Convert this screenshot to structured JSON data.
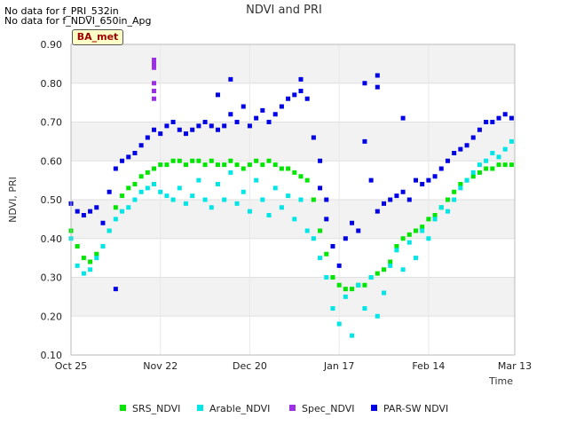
{
  "notes": {
    "line1": "No data for f_PRI_532in",
    "line2": "No data for f_NDVI_650in_Apg"
  },
  "badge": "BA_met",
  "chart_data": {
    "type": "scatter",
    "title": "NDVI and PRI",
    "xlabel": "Time",
    "ylabel": "NDVI, PRI",
    "ylim": [
      0.1,
      0.9
    ],
    "yticks": [
      "0.10",
      "0.20",
      "0.30",
      "0.40",
      "0.50",
      "0.60",
      "0.70",
      "0.80",
      "0.90"
    ],
    "xlim": [
      "2017-10-25",
      "2018-03-13"
    ],
    "xticks": [
      {
        "date": "2017-10-25",
        "label": "Oct 25"
      },
      {
        "date": "2017-11-22",
        "label": "Nov 22"
      },
      {
        "date": "2017-12-20",
        "label": "Dec 20"
      },
      {
        "date": "2018-01-17",
        "label": "Jan 17"
      },
      {
        "date": "2018-02-14",
        "label": "Feb 14"
      },
      {
        "date": "2018-03-13",
        "label": "Mar 13"
      }
    ],
    "grid": true,
    "legend_position": "bottom",
    "series": [
      {
        "name": "SRS_NDVI",
        "color": "#00e600",
        "points": [
          [
            "2017-10-25",
            0.42
          ],
          [
            "2017-10-27",
            0.38
          ],
          [
            "2017-10-29",
            0.35
          ],
          [
            "2017-10-31",
            0.34
          ],
          [
            "2017-11-02",
            0.36
          ],
          [
            "2017-11-04",
            0.38
          ],
          [
            "2017-11-06",
            0.42
          ],
          [
            "2017-11-08",
            0.48
          ],
          [
            "2017-11-10",
            0.51
          ],
          [
            "2017-11-12",
            0.53
          ],
          [
            "2017-11-14",
            0.54
          ],
          [
            "2017-11-16",
            0.56
          ],
          [
            "2017-11-18",
            0.57
          ],
          [
            "2017-11-20",
            0.58
          ],
          [
            "2017-11-22",
            0.59
          ],
          [
            "2017-11-24",
            0.59
          ],
          [
            "2017-11-26",
            0.6
          ],
          [
            "2017-11-28",
            0.6
          ],
          [
            "2017-11-30",
            0.59
          ],
          [
            "2017-12-02",
            0.6
          ],
          [
            "2017-12-04",
            0.6
          ],
          [
            "2017-12-06",
            0.59
          ],
          [
            "2017-12-08",
            0.6
          ],
          [
            "2017-12-10",
            0.59
          ],
          [
            "2017-12-12",
            0.59
          ],
          [
            "2017-12-14",
            0.6
          ],
          [
            "2017-12-16",
            0.59
          ],
          [
            "2017-12-18",
            0.58
          ],
          [
            "2017-12-20",
            0.59
          ],
          [
            "2017-12-22",
            0.6
          ],
          [
            "2017-12-24",
            0.59
          ],
          [
            "2017-12-26",
            0.6
          ],
          [
            "2017-12-28",
            0.59
          ],
          [
            "2017-12-30",
            0.58
          ],
          [
            "2018-01-01",
            0.58
          ],
          [
            "2018-01-03",
            0.57
          ],
          [
            "2018-01-05",
            0.56
          ],
          [
            "2018-01-07",
            0.55
          ],
          [
            "2018-01-09",
            0.5
          ],
          [
            "2018-01-11",
            0.42
          ],
          [
            "2018-01-13",
            0.36
          ],
          [
            "2018-01-15",
            0.3
          ],
          [
            "2018-01-17",
            0.28
          ],
          [
            "2018-01-19",
            0.27
          ],
          [
            "2018-01-21",
            0.27
          ],
          [
            "2018-01-23",
            0.28
          ],
          [
            "2018-01-25",
            0.28
          ],
          [
            "2018-01-27",
            0.3
          ],
          [
            "2018-01-29",
            0.31
          ],
          [
            "2018-01-31",
            0.32
          ],
          [
            "2018-02-02",
            0.34
          ],
          [
            "2018-02-04",
            0.38
          ],
          [
            "2018-02-06",
            0.4
          ],
          [
            "2018-02-08",
            0.41
          ],
          [
            "2018-02-10",
            0.42
          ],
          [
            "2018-02-12",
            0.43
          ],
          [
            "2018-02-14",
            0.45
          ],
          [
            "2018-02-16",
            0.46
          ],
          [
            "2018-02-18",
            0.48
          ],
          [
            "2018-02-20",
            0.5
          ],
          [
            "2018-02-22",
            0.52
          ],
          [
            "2018-02-24",
            0.54
          ],
          [
            "2018-02-26",
            0.55
          ],
          [
            "2018-02-28",
            0.56
          ],
          [
            "2018-03-02",
            0.57
          ],
          [
            "2018-03-04",
            0.58
          ],
          [
            "2018-03-06",
            0.58
          ],
          [
            "2018-03-08",
            0.59
          ],
          [
            "2018-03-10",
            0.59
          ],
          [
            "2018-03-12",
            0.59
          ]
        ]
      },
      {
        "name": "Arable_NDVI",
        "color": "#00e6e6",
        "points": [
          [
            "2017-10-25",
            0.4
          ],
          [
            "2017-10-27",
            0.33
          ],
          [
            "2017-10-29",
            0.31
          ],
          [
            "2017-10-31",
            0.32
          ],
          [
            "2017-11-02",
            0.35
          ],
          [
            "2017-11-04",
            0.38
          ],
          [
            "2017-11-06",
            0.42
          ],
          [
            "2017-11-08",
            0.45
          ],
          [
            "2017-11-10",
            0.47
          ],
          [
            "2017-11-12",
            0.48
          ],
          [
            "2017-11-14",
            0.5
          ],
          [
            "2017-11-16",
            0.52
          ],
          [
            "2017-11-18",
            0.53
          ],
          [
            "2017-11-20",
            0.54
          ],
          [
            "2017-11-22",
            0.52
          ],
          [
            "2017-11-24",
            0.51
          ],
          [
            "2017-11-26",
            0.5
          ],
          [
            "2017-11-28",
            0.53
          ],
          [
            "2017-11-30",
            0.49
          ],
          [
            "2017-12-02",
            0.51
          ],
          [
            "2017-12-04",
            0.55
          ],
          [
            "2017-12-06",
            0.5
          ],
          [
            "2017-12-08",
            0.48
          ],
          [
            "2017-12-10",
            0.54
          ],
          [
            "2017-12-12",
            0.5
          ],
          [
            "2017-12-14",
            0.57
          ],
          [
            "2017-12-16",
            0.49
          ],
          [
            "2017-12-18",
            0.52
          ],
          [
            "2017-12-20",
            0.47
          ],
          [
            "2017-12-22",
            0.55
          ],
          [
            "2017-12-24",
            0.5
          ],
          [
            "2017-12-26",
            0.46
          ],
          [
            "2017-12-28",
            0.53
          ],
          [
            "2017-12-30",
            0.48
          ],
          [
            "2018-01-01",
            0.51
          ],
          [
            "2018-01-03",
            0.45
          ],
          [
            "2018-01-05",
            0.5
          ],
          [
            "2018-01-07",
            0.42
          ],
          [
            "2018-01-09",
            0.4
          ],
          [
            "2018-01-11",
            0.35
          ],
          [
            "2018-01-13",
            0.3
          ],
          [
            "2018-01-15",
            0.22
          ],
          [
            "2018-01-17",
            0.18
          ],
          [
            "2018-01-19",
            0.25
          ],
          [
            "2018-01-21",
            0.15
          ],
          [
            "2018-01-23",
            0.28
          ],
          [
            "2018-01-25",
            0.22
          ],
          [
            "2018-01-27",
            0.3
          ],
          [
            "2018-01-29",
            0.2
          ],
          [
            "2018-01-31",
            0.26
          ],
          [
            "2018-02-02",
            0.33
          ],
          [
            "2018-02-04",
            0.37
          ],
          [
            "2018-02-06",
            0.32
          ],
          [
            "2018-02-08",
            0.39
          ],
          [
            "2018-02-10",
            0.35
          ],
          [
            "2018-02-12",
            0.42
          ],
          [
            "2018-02-14",
            0.4
          ],
          [
            "2018-02-16",
            0.45
          ],
          [
            "2018-02-18",
            0.48
          ],
          [
            "2018-02-20",
            0.47
          ],
          [
            "2018-02-22",
            0.5
          ],
          [
            "2018-02-24",
            0.53
          ],
          [
            "2018-02-26",
            0.55
          ],
          [
            "2018-02-28",
            0.57
          ],
          [
            "2018-03-02",
            0.59
          ],
          [
            "2018-03-04",
            0.6
          ],
          [
            "2018-03-06",
            0.62
          ],
          [
            "2018-03-08",
            0.61
          ],
          [
            "2018-03-10",
            0.63
          ],
          [
            "2018-03-12",
            0.65
          ]
        ]
      },
      {
        "name": "Spec_NDVI",
        "color": "#9b30e6",
        "points": [
          [
            "2017-11-20",
            0.86
          ],
          [
            "2017-11-20",
            0.85
          ],
          [
            "2017-11-20",
            0.84
          ],
          [
            "2017-11-20",
            0.8
          ],
          [
            "2017-11-20",
            0.78
          ],
          [
            "2017-11-20",
            0.76
          ]
        ]
      },
      {
        "name": "PAR-SW NDVI",
        "color": "#0000e6",
        "points": [
          [
            "2017-10-25",
            0.49
          ],
          [
            "2017-10-27",
            0.47
          ],
          [
            "2017-10-29",
            0.46
          ],
          [
            "2017-10-31",
            0.47
          ],
          [
            "2017-11-02",
            0.48
          ],
          [
            "2017-11-04",
            0.44
          ],
          [
            "2017-11-06",
            0.52
          ],
          [
            "2017-11-08",
            0.58
          ],
          [
            "2017-11-10",
            0.6
          ],
          [
            "2017-11-12",
            0.61
          ],
          [
            "2017-11-14",
            0.62
          ],
          [
            "2017-11-16",
            0.64
          ],
          [
            "2017-11-18",
            0.66
          ],
          [
            "2017-11-20",
            0.68
          ],
          [
            "2017-11-22",
            0.67
          ],
          [
            "2017-11-24",
            0.69
          ],
          [
            "2017-11-26",
            0.7
          ],
          [
            "2017-11-28",
            0.68
          ],
          [
            "2017-11-30",
            0.67
          ],
          [
            "2017-12-02",
            0.68
          ],
          [
            "2017-12-04",
            0.69
          ],
          [
            "2017-12-06",
            0.7
          ],
          [
            "2017-12-08",
            0.69
          ],
          [
            "2017-12-10",
            0.68
          ],
          [
            "2017-12-12",
            0.69
          ],
          [
            "2017-12-14",
            0.72
          ],
          [
            "2017-12-16",
            0.7
          ],
          [
            "2017-12-18",
            0.74
          ],
          [
            "2017-12-20",
            0.69
          ],
          [
            "2017-12-22",
            0.71
          ],
          [
            "2017-12-24",
            0.73
          ],
          [
            "2017-12-26",
            0.7
          ],
          [
            "2017-12-28",
            0.72
          ],
          [
            "2017-12-30",
            0.74
          ],
          [
            "2018-01-01",
            0.76
          ],
          [
            "2018-01-03",
            0.77
          ],
          [
            "2018-01-05",
            0.78
          ],
          [
            "2018-01-07",
            0.76
          ],
          [
            "2018-01-09",
            0.66
          ],
          [
            "2018-01-11",
            0.6
          ],
          [
            "2018-01-13",
            0.5
          ],
          [
            "2018-01-15",
            0.38
          ],
          [
            "2018-01-17",
            0.33
          ],
          [
            "2018-01-19",
            0.4
          ],
          [
            "2018-01-21",
            0.44
          ],
          [
            "2018-01-23",
            0.42
          ],
          [
            "2018-01-25",
            0.65
          ],
          [
            "2018-01-27",
            0.55
          ],
          [
            "2018-01-29",
            0.47
          ],
          [
            "2018-01-31",
            0.49
          ],
          [
            "2018-02-02",
            0.5
          ],
          [
            "2018-02-04",
            0.51
          ],
          [
            "2018-02-06",
            0.52
          ],
          [
            "2018-02-08",
            0.5
          ],
          [
            "2018-02-10",
            0.55
          ],
          [
            "2018-02-12",
            0.54
          ],
          [
            "2018-02-14",
            0.55
          ],
          [
            "2018-02-16",
            0.56
          ],
          [
            "2018-02-18",
            0.58
          ],
          [
            "2018-02-20",
            0.6
          ],
          [
            "2018-02-22",
            0.62
          ],
          [
            "2018-02-24",
            0.63
          ],
          [
            "2018-02-26",
            0.64
          ],
          [
            "2018-02-28",
            0.66
          ],
          [
            "2018-03-02",
            0.68
          ],
          [
            "2018-03-04",
            0.7
          ],
          [
            "2018-03-06",
            0.7
          ],
          [
            "2018-03-08",
            0.71
          ],
          [
            "2018-03-10",
            0.72
          ],
          [
            "2018-03-12",
            0.71
          ],
          [
            "2017-11-08",
            0.27
          ],
          [
            "2017-12-14",
            0.81
          ],
          [
            "2017-12-10",
            0.77
          ],
          [
            "2018-01-05",
            0.81
          ],
          [
            "2018-01-25",
            0.8
          ],
          [
            "2018-01-29",
            0.82
          ],
          [
            "2018-01-29",
            0.79
          ],
          [
            "2018-02-06",
            0.71
          ],
          [
            "2018-01-13",
            0.45
          ],
          [
            "2018-01-11",
            0.53
          ]
        ]
      }
    ]
  }
}
